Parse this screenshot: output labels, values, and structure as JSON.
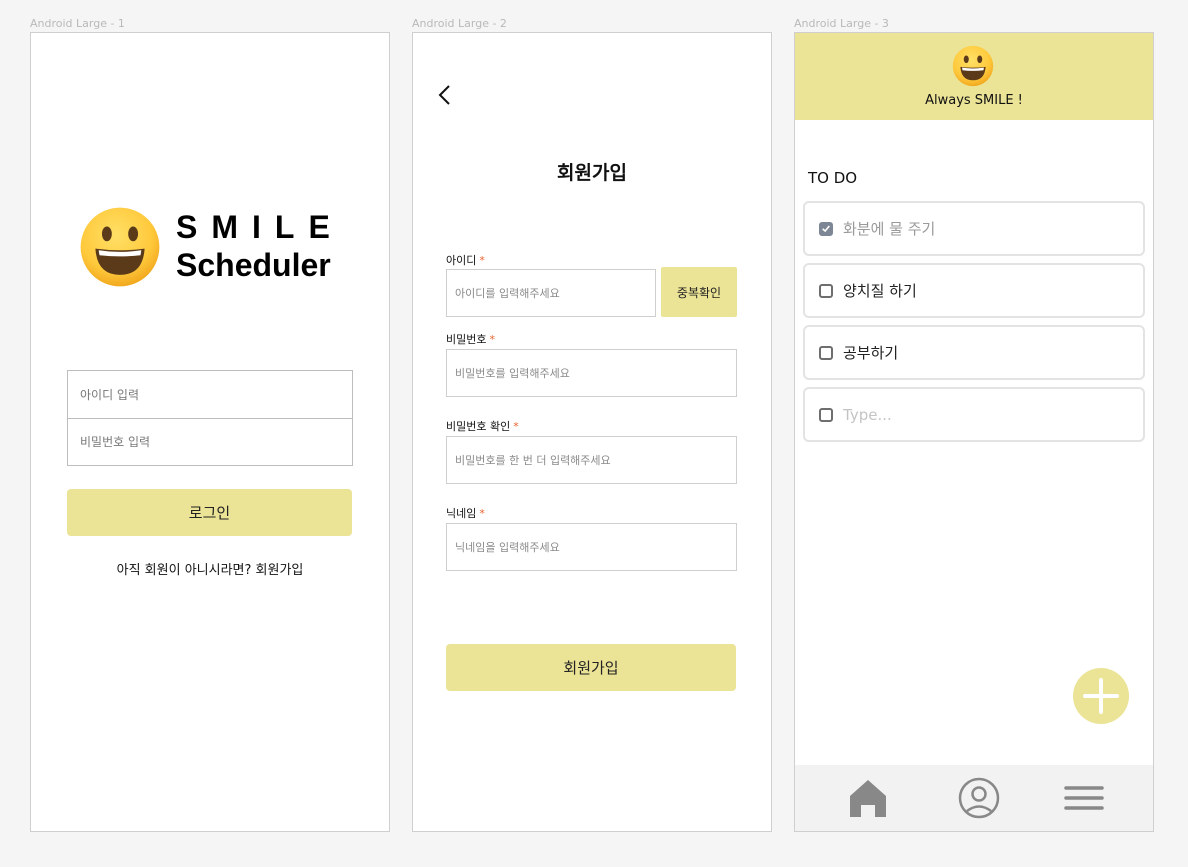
{
  "frames": {
    "login": {
      "label": "Android Large - 1",
      "brand_line1": "SMILE",
      "brand_line2": "Scheduler",
      "id_placeholder": "아이디 입력",
      "pw_placeholder": "비밀번호 입력",
      "login_label": "로그인",
      "signup_prompt": "아직 회원이 아니시라면? 회원가입"
    },
    "signup": {
      "label": "Android Large - 2",
      "title": "회원가입",
      "fields": [
        {
          "label": "아이디",
          "required_mark": "*",
          "placeholder": "아이디를 입력해주세요"
        },
        {
          "label": "비밀번호",
          "required_mark": "*",
          "placeholder": "비밀번호를 입력해주세요"
        },
        {
          "label": "비밀번호 확인",
          "required_mark": "*",
          "placeholder": "비밀번호를 한 번 더 입력해주세요"
        },
        {
          "label": "닉네임",
          "required_mark": "*",
          "placeholder": "닉네임을 입력해주세요"
        }
      ],
      "duplicate_check_label": "중복확인",
      "submit_label": "회원가입"
    },
    "todo": {
      "label": "Android Large - 3",
      "header_text": "Always SMILE !",
      "section_title": "TO DO",
      "items": [
        {
          "text": "화분에 물 주기",
          "checked": true
        },
        {
          "text": "양치질 하기",
          "checked": false
        },
        {
          "text": "공부하기",
          "checked": false
        }
      ],
      "new_item_placeholder": "Type...",
      "nav": [
        {
          "icon": "home-icon"
        },
        {
          "icon": "profile-icon"
        },
        {
          "icon": "menu-icon"
        }
      ]
    }
  },
  "colors": {
    "accent_yellow": "#ebe396",
    "required_orange": "#e8642e",
    "checked_gray": "#7d8694"
  }
}
